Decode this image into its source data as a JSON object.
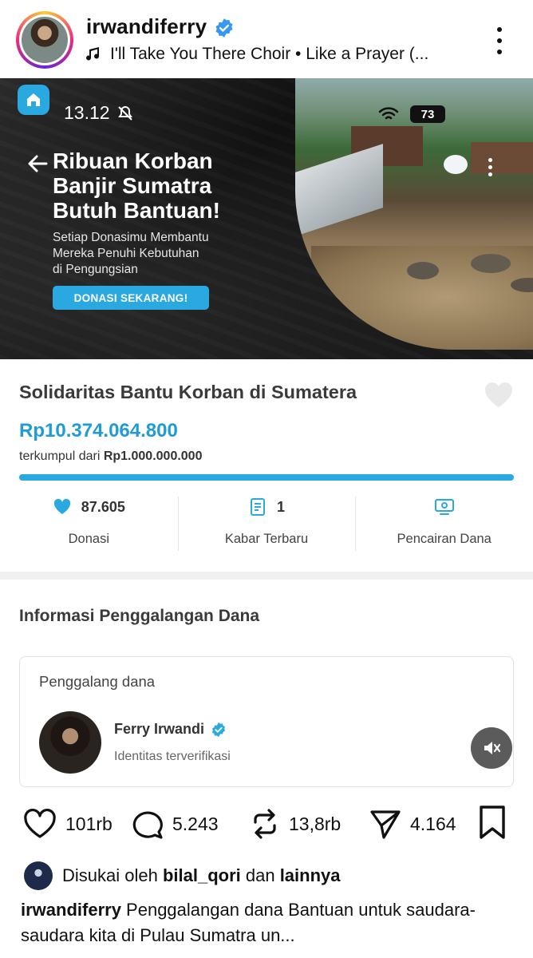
{
  "post_header": {
    "username": "irwandiferry",
    "music": "I'll Take You There Choir • Like a Prayer (..."
  },
  "banner": {
    "time": "13.12",
    "battery": "73",
    "headline_lines": [
      "Ribuan Korban",
      "Banjir Sumatra",
      "Butuh Bantuan!"
    ],
    "subtext_lines": [
      "Setiap Donasimu Membantu",
      "Mereka Penuhi Kebutuhan",
      "di Pengungsian"
    ],
    "cta_label": "DONASI SEKARANG!"
  },
  "campaign": {
    "title": "Solidaritas Bantu Korban di Sumatera",
    "amount": "Rp10.374.064.800",
    "target_prefix": "terkumpul dari ",
    "target_amount": "Rp1.000.000.000",
    "progress_fraction": 1.0,
    "stats": {
      "donations_count": "87.605",
      "donations_label": "Donasi",
      "news_count": "1",
      "news_label": "Kabar Terbaru",
      "withdraw_label": "Pencairan Dana"
    }
  },
  "info": {
    "section_title": "Informasi Penggalangan Dana",
    "organizer_label": "Penggalang dana",
    "organizer_name": "Ferry Irwandi",
    "organizer_status": "Identitas terverifikasi"
  },
  "actions": {
    "likes": "101rb",
    "comments": "5.243",
    "reposts": "13,8rb",
    "shares": "4.164"
  },
  "liked_by": {
    "prefix": "Disukai oleh ",
    "user": "bilal_qori",
    "middle": " dan ",
    "suffix": "lainnya"
  },
  "caption": {
    "username": "irwandiferry",
    "text": " Penggalangan dana Bantuan untuk saudara-saudara kita di Pulau Sumatra un..."
  },
  "colors": {
    "accent": "#2aa8e0",
    "amount": "#1f9bd6",
    "verified": "#3897f0"
  },
  "icons": [
    "music-note-icon",
    "verified-badge-icon",
    "more-options-icon",
    "home-badge-icon",
    "mute-bell-icon",
    "wifi-icon",
    "back-arrow-icon",
    "heart-outline-icon",
    "donation-heart-icon",
    "news-document-icon",
    "withdraw-money-icon",
    "volume-muted-icon",
    "like-icon",
    "comment-icon",
    "repost-icon",
    "share-icon",
    "bookmark-icon"
  ]
}
